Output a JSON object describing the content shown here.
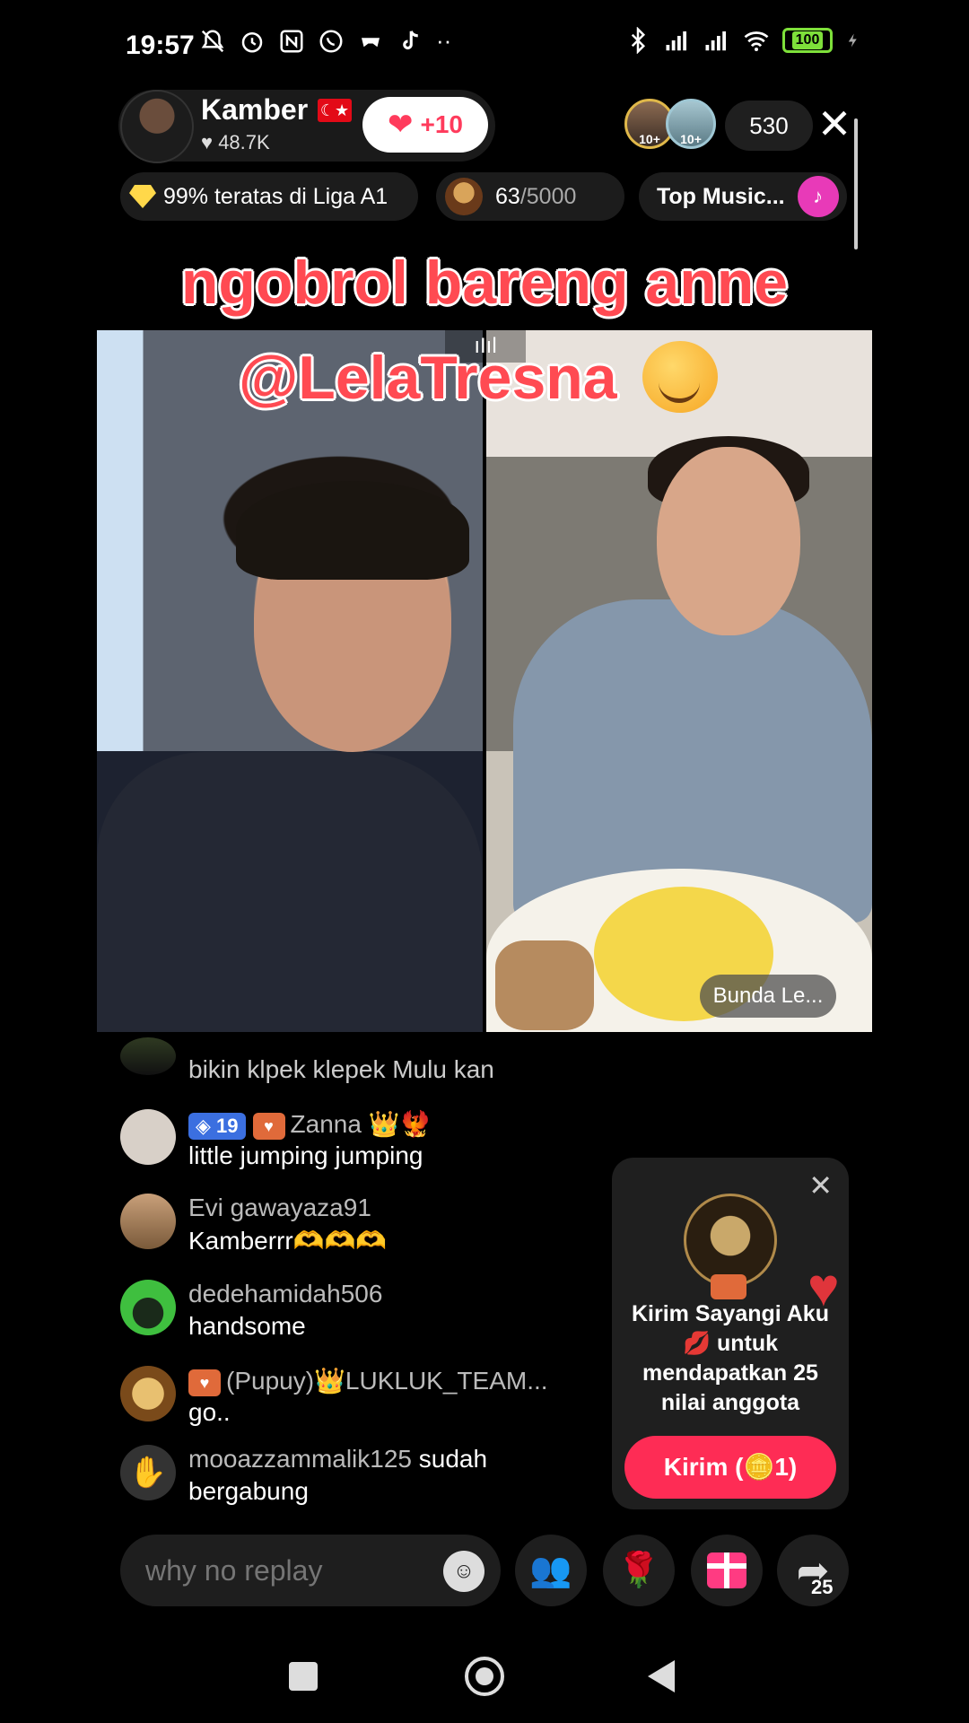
{
  "status_bar": {
    "time": "19:57",
    "battery": "100",
    "icons": [
      "mute-icon",
      "alarm-icon",
      "nfc-icon",
      "whatsapp-icon",
      "game-icon",
      "tiktok-icon",
      "more-icon",
      "bluetooth-icon",
      "signal-icon",
      "signal-icon",
      "wifi-icon",
      "battery-icon",
      "charging-icon"
    ]
  },
  "host": {
    "name": "Kamber",
    "likes": "48.7K",
    "follow_label": "+10"
  },
  "viewers": {
    "avatar_labels": [
      "10+",
      "10+"
    ],
    "count": "530"
  },
  "chips": {
    "league": "99% teratas di Liga A1",
    "progress_current": "63",
    "progress_total": "/5000",
    "music": "Top Music..."
  },
  "stream": {
    "title": "ngobrol bareng anne",
    "mention": "@LelaTresna",
    "guest_tag": "Bunda Le..."
  },
  "comments": [
    {
      "user": "",
      "text": "bikin klpek klepek Mulu kan"
    },
    {
      "level": "19",
      "user": "Zanna 👑🐦‍🔥",
      "text": "little jumping jumping"
    },
    {
      "user": "Evi gawayaza91",
      "text": "Kamberrr🫶🫶🫶"
    },
    {
      "user": "dedehamidah506",
      "text": "handsome"
    },
    {
      "user": "(Pupuy)👑LUKLUK_TEAM...",
      "text": "go.."
    },
    {
      "user": "mooazzammalik125",
      "join_text": "sudah",
      "text": "bergabung"
    }
  ],
  "popup": {
    "text": "Kirim Sayangi Aku 💋 untuk mendapatkan 25 nilai anggota",
    "button": "Kirim (🪙1)"
  },
  "input": {
    "placeholder": "why no replay"
  },
  "share_count": "25",
  "colors": {
    "accent": "#fe2c55",
    "title_red": "#ff4a52",
    "battery_green": "#7ee03a"
  }
}
